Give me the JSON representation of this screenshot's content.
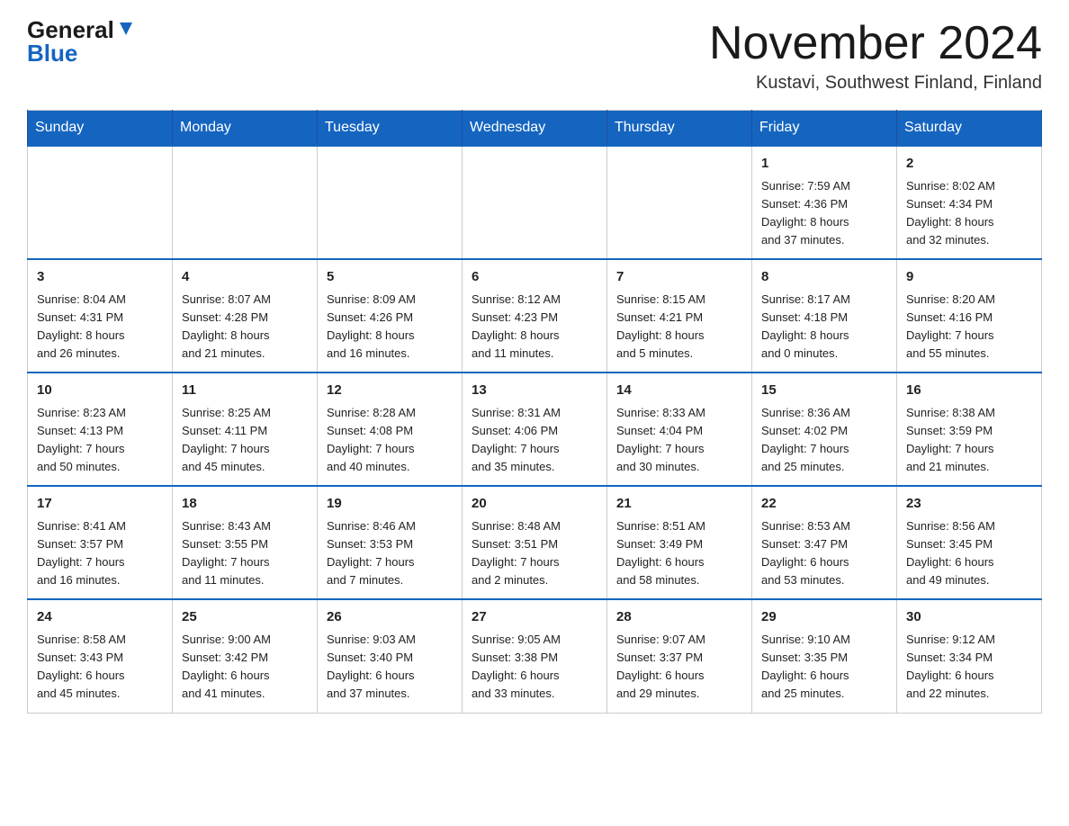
{
  "logo": {
    "general": "General",
    "triangle": "▼",
    "blue": "Blue"
  },
  "header": {
    "month_title": "November 2024",
    "location": "Kustavi, Southwest Finland, Finland"
  },
  "days_of_week": [
    "Sunday",
    "Monday",
    "Tuesday",
    "Wednesday",
    "Thursday",
    "Friday",
    "Saturday"
  ],
  "weeks": [
    [
      {
        "day": "",
        "info": ""
      },
      {
        "day": "",
        "info": ""
      },
      {
        "day": "",
        "info": ""
      },
      {
        "day": "",
        "info": ""
      },
      {
        "day": "",
        "info": ""
      },
      {
        "day": "1",
        "info": "Sunrise: 7:59 AM\nSunset: 4:36 PM\nDaylight: 8 hours\nand 37 minutes."
      },
      {
        "day": "2",
        "info": "Sunrise: 8:02 AM\nSunset: 4:34 PM\nDaylight: 8 hours\nand 32 minutes."
      }
    ],
    [
      {
        "day": "3",
        "info": "Sunrise: 8:04 AM\nSunset: 4:31 PM\nDaylight: 8 hours\nand 26 minutes."
      },
      {
        "day": "4",
        "info": "Sunrise: 8:07 AM\nSunset: 4:28 PM\nDaylight: 8 hours\nand 21 minutes."
      },
      {
        "day": "5",
        "info": "Sunrise: 8:09 AM\nSunset: 4:26 PM\nDaylight: 8 hours\nand 16 minutes."
      },
      {
        "day": "6",
        "info": "Sunrise: 8:12 AM\nSunset: 4:23 PM\nDaylight: 8 hours\nand 11 minutes."
      },
      {
        "day": "7",
        "info": "Sunrise: 8:15 AM\nSunset: 4:21 PM\nDaylight: 8 hours\nand 5 minutes."
      },
      {
        "day": "8",
        "info": "Sunrise: 8:17 AM\nSunset: 4:18 PM\nDaylight: 8 hours\nand 0 minutes."
      },
      {
        "day": "9",
        "info": "Sunrise: 8:20 AM\nSunset: 4:16 PM\nDaylight: 7 hours\nand 55 minutes."
      }
    ],
    [
      {
        "day": "10",
        "info": "Sunrise: 8:23 AM\nSunset: 4:13 PM\nDaylight: 7 hours\nand 50 minutes."
      },
      {
        "day": "11",
        "info": "Sunrise: 8:25 AM\nSunset: 4:11 PM\nDaylight: 7 hours\nand 45 minutes."
      },
      {
        "day": "12",
        "info": "Sunrise: 8:28 AM\nSunset: 4:08 PM\nDaylight: 7 hours\nand 40 minutes."
      },
      {
        "day": "13",
        "info": "Sunrise: 8:31 AM\nSunset: 4:06 PM\nDaylight: 7 hours\nand 35 minutes."
      },
      {
        "day": "14",
        "info": "Sunrise: 8:33 AM\nSunset: 4:04 PM\nDaylight: 7 hours\nand 30 minutes."
      },
      {
        "day": "15",
        "info": "Sunrise: 8:36 AM\nSunset: 4:02 PM\nDaylight: 7 hours\nand 25 minutes."
      },
      {
        "day": "16",
        "info": "Sunrise: 8:38 AM\nSunset: 3:59 PM\nDaylight: 7 hours\nand 21 minutes."
      }
    ],
    [
      {
        "day": "17",
        "info": "Sunrise: 8:41 AM\nSunset: 3:57 PM\nDaylight: 7 hours\nand 16 minutes."
      },
      {
        "day": "18",
        "info": "Sunrise: 8:43 AM\nSunset: 3:55 PM\nDaylight: 7 hours\nand 11 minutes."
      },
      {
        "day": "19",
        "info": "Sunrise: 8:46 AM\nSunset: 3:53 PM\nDaylight: 7 hours\nand 7 minutes."
      },
      {
        "day": "20",
        "info": "Sunrise: 8:48 AM\nSunset: 3:51 PM\nDaylight: 7 hours\nand 2 minutes."
      },
      {
        "day": "21",
        "info": "Sunrise: 8:51 AM\nSunset: 3:49 PM\nDaylight: 6 hours\nand 58 minutes."
      },
      {
        "day": "22",
        "info": "Sunrise: 8:53 AM\nSunset: 3:47 PM\nDaylight: 6 hours\nand 53 minutes."
      },
      {
        "day": "23",
        "info": "Sunrise: 8:56 AM\nSunset: 3:45 PM\nDaylight: 6 hours\nand 49 minutes."
      }
    ],
    [
      {
        "day": "24",
        "info": "Sunrise: 8:58 AM\nSunset: 3:43 PM\nDaylight: 6 hours\nand 45 minutes."
      },
      {
        "day": "25",
        "info": "Sunrise: 9:00 AM\nSunset: 3:42 PM\nDaylight: 6 hours\nand 41 minutes."
      },
      {
        "day": "26",
        "info": "Sunrise: 9:03 AM\nSunset: 3:40 PM\nDaylight: 6 hours\nand 37 minutes."
      },
      {
        "day": "27",
        "info": "Sunrise: 9:05 AM\nSunset: 3:38 PM\nDaylight: 6 hours\nand 33 minutes."
      },
      {
        "day": "28",
        "info": "Sunrise: 9:07 AM\nSunset: 3:37 PM\nDaylight: 6 hours\nand 29 minutes."
      },
      {
        "day": "29",
        "info": "Sunrise: 9:10 AM\nSunset: 3:35 PM\nDaylight: 6 hours\nand 25 minutes."
      },
      {
        "day": "30",
        "info": "Sunrise: 9:12 AM\nSunset: 3:34 PM\nDaylight: 6 hours\nand 22 minutes."
      }
    ]
  ]
}
